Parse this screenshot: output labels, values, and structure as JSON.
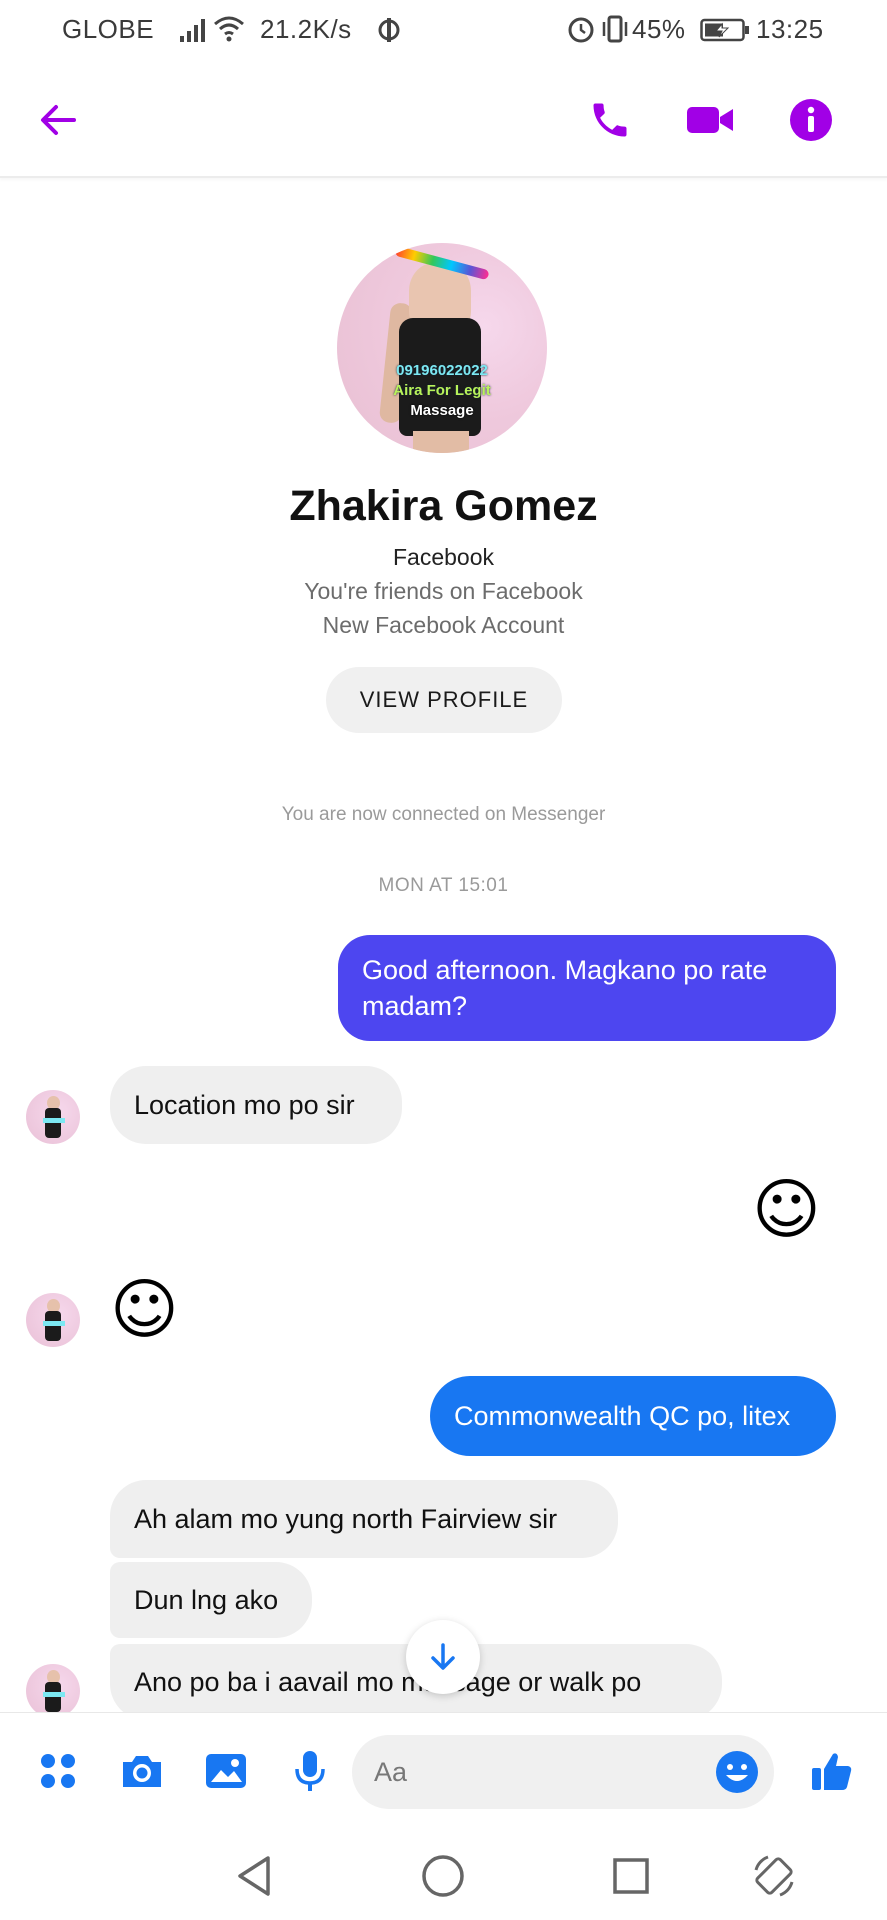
{
  "status_bar": {
    "carrier": "GLOBE",
    "speed": "21.2K/s",
    "battery": "45%",
    "time": "13:25"
  },
  "header": {
    "back_icon": "back-arrow-icon",
    "call_icon": "phone-icon",
    "video_icon": "video-camera-icon",
    "info_icon": "info-icon",
    "accent": "#a100e6"
  },
  "profile": {
    "avatar_text": [
      "09196022022",
      "Aira For Legit",
      "Massage"
    ],
    "name": "Zhakira Gomez",
    "source": "Facebook",
    "friends_line": "You're friends on Facebook",
    "account_line": "New Facebook Account",
    "view_profile_label": "VIEW PROFILE"
  },
  "conversation": {
    "connected_text": "You are now connected on Messenger",
    "timestamp": "MON AT 15:01",
    "messages": [
      {
        "from": "me",
        "type": "text",
        "text": "Good afternoon. Magkano po rate madam?"
      },
      {
        "from": "them",
        "type": "text",
        "text": "Location mo po sir"
      },
      {
        "from": "me",
        "type": "emoji",
        "text": "☺"
      },
      {
        "from": "them",
        "type": "emoji",
        "text": "☺"
      },
      {
        "from": "me",
        "type": "text",
        "text": "Commonwealth QC po, litex"
      },
      {
        "from": "them",
        "type": "text",
        "text": "Ah alam mo yung north Fairview sir"
      },
      {
        "from": "them",
        "type": "text",
        "text": "Dun lng ako"
      },
      {
        "from": "them",
        "type": "text",
        "text": "Ano po ba i aavail mo massage or walk po"
      }
    ],
    "outgoing_color": "#4d46f0",
    "outgoing_color_2": "#1877f2",
    "incoming_color": "#efefef"
  },
  "composer": {
    "placeholder": "Aa",
    "icons": [
      "apps-icon",
      "camera-icon",
      "gallery-icon",
      "microphone-icon",
      "emoji-icon",
      "thumbs-up-icon"
    ],
    "accent": "#1877f2"
  },
  "navbar": {
    "icons": [
      "back-triangle-icon",
      "home-circle-icon",
      "recents-square-icon",
      "rotate-icon"
    ]
  }
}
